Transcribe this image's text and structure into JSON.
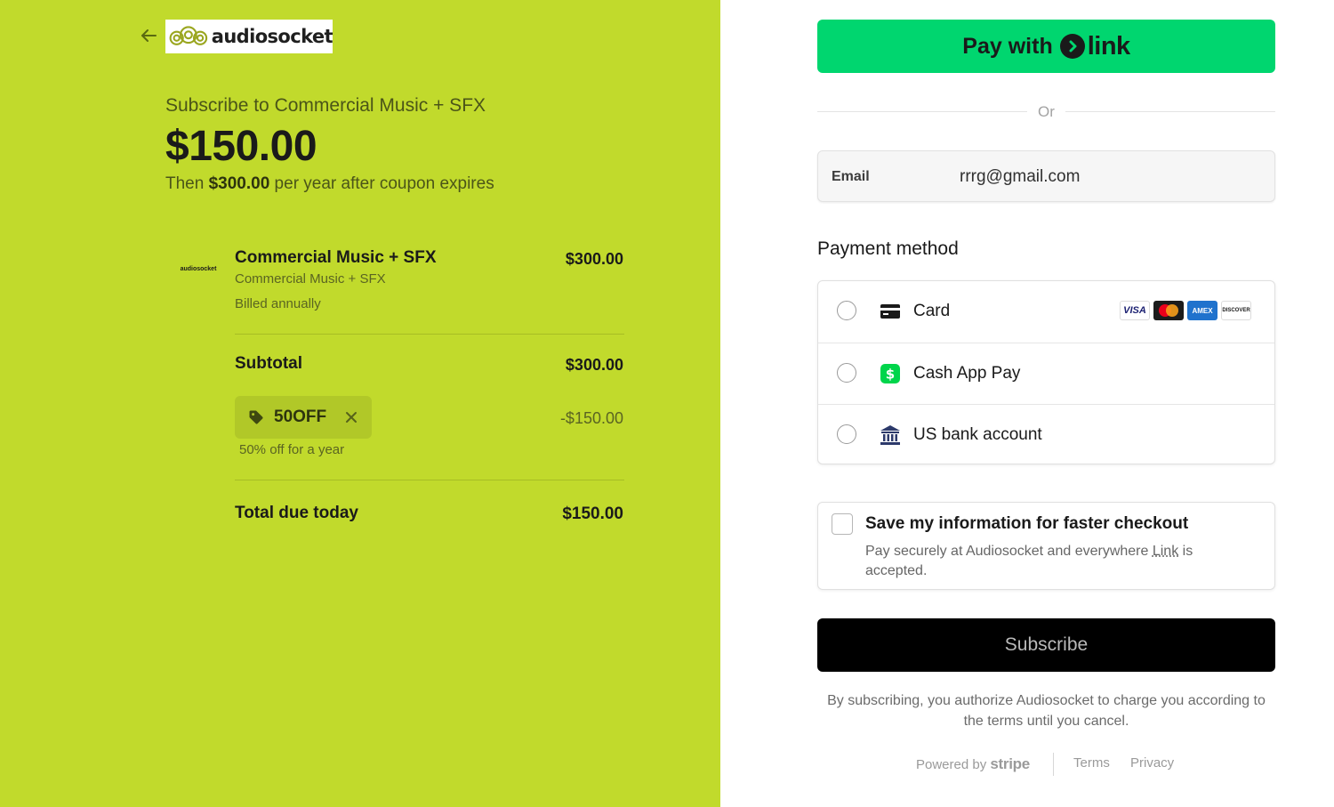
{
  "brand": {
    "logo_text": "audiosocket",
    "theme_color": "#c1da2c"
  },
  "summary": {
    "subscribe_title": "Subscribe to Commercial Music + SFX",
    "price_today": "$150.00",
    "then_prefix": "Then ",
    "then_amount": "$300.00",
    "then_suffix": " per year after coupon expires"
  },
  "line_item": {
    "thumb_text": "audiosocket",
    "name": "Commercial Music + SFX",
    "description": "Commercial Music + SFX",
    "billing": "Billed annually",
    "price": "$300.00"
  },
  "totals": {
    "subtotal_label": "Subtotal",
    "subtotal_value": "$300.00",
    "coupon_code": "50OFF",
    "coupon_description": "50% off for a year",
    "discount_value": "-$150.00",
    "total_label": "Total due today",
    "total_value": "$150.00"
  },
  "checkout": {
    "link_button_prefix": "Pay with",
    "link_button_brand": "link",
    "link_color": "#00d66f",
    "or_text": "Or",
    "email_label": "Email",
    "email_value": "rrrg@gmail.com",
    "payment_method_heading": "Payment method",
    "payment_methods": [
      {
        "label": "Card",
        "icon": "credit-card-icon"
      },
      {
        "label": "Cash App Pay",
        "icon": "cash-app-icon"
      },
      {
        "label": "US bank account",
        "icon": "bank-icon"
      }
    ],
    "card_brands": [
      "VISA",
      "mastercard",
      "AMEX",
      "DISCOVER"
    ],
    "save_title": "Save my information for faster checkout",
    "save_desc_prefix": "Pay securely at Audiosocket and everywhere ",
    "save_desc_link": "Link",
    "save_desc_suffix": " is accepted.",
    "subscribe_label": "Subscribe",
    "legal_text": "By subscribing, you authorize Audiosocket to charge you according to the terms until you cancel."
  },
  "footer": {
    "powered_by": "Powered by",
    "stripe": "stripe",
    "terms": "Terms",
    "privacy": "Privacy"
  }
}
